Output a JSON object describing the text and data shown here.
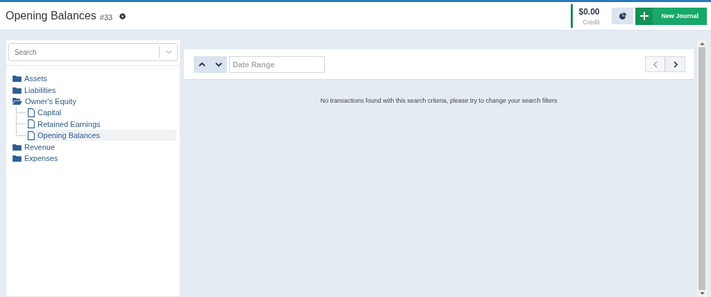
{
  "header": {
    "title": "Opening Balances",
    "number": "#33",
    "balance": "$0.00",
    "balance_label": "Credit",
    "new_button": "New Journal"
  },
  "sidebar": {
    "search_placeholder": "Search",
    "tree": [
      {
        "label": "Assets",
        "expanded": false,
        "selected": false
      },
      {
        "label": "Liabilities",
        "expanded": false,
        "selected": false
      },
      {
        "label": "Owner's Equity",
        "expanded": true,
        "selected": false,
        "children": [
          {
            "label": "Capital",
            "selected": false
          },
          {
            "label": "Retained Earnings",
            "selected": false
          },
          {
            "label": "Opening Balances",
            "selected": true
          }
        ]
      },
      {
        "label": "Revenue",
        "expanded": false,
        "selected": false
      },
      {
        "label": "Expenses",
        "expanded": false,
        "selected": false
      }
    ]
  },
  "toolbar": {
    "date_placeholder": "Date Range",
    "prev_disabled": true,
    "next_disabled": false
  },
  "empty_message": "No transactions found with this search criteria, please try to change your search filters"
}
